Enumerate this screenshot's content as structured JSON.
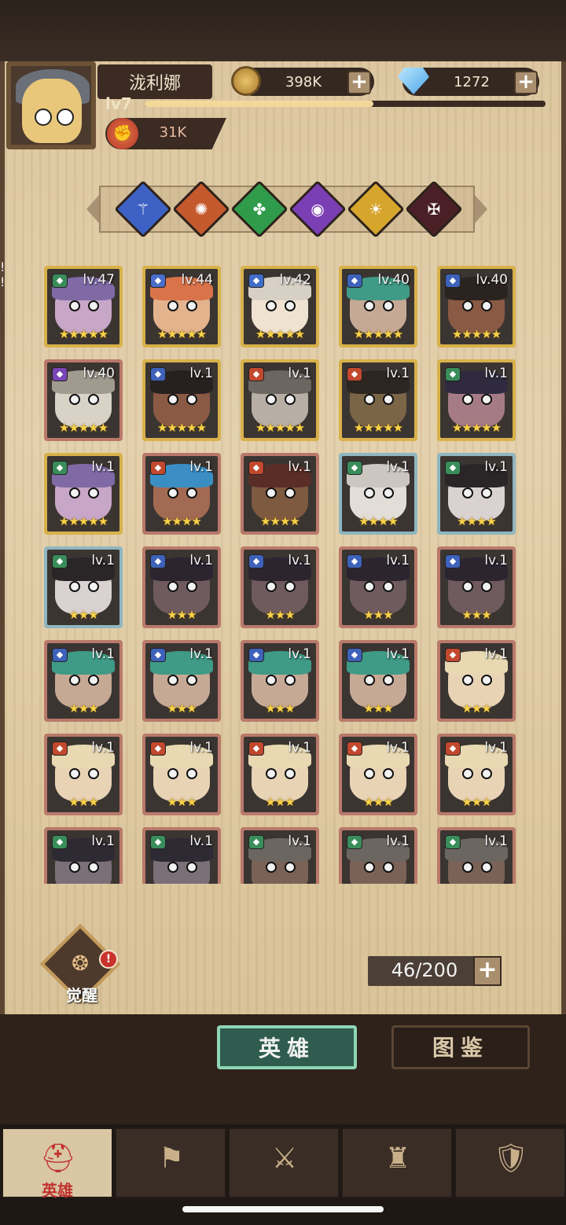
{
  "player": {
    "name": "泷利娜",
    "level_label": "lv7",
    "xp_fraction": 0.57,
    "power": "31K"
  },
  "resources": {
    "coins": "398K",
    "gems": "1272"
  },
  "filters": [
    {
      "name": "blue-faction-icon",
      "color": "#3d61c4",
      "glyph": "⚚"
    },
    {
      "name": "orange-faction-icon",
      "color": "#c5592e",
      "glyph": "✺"
    },
    {
      "name": "green-faction-icon",
      "color": "#2f9b4b",
      "glyph": "✤"
    },
    {
      "name": "purple-faction-icon",
      "color": "#7b3fb4",
      "glyph": "◉"
    },
    {
      "name": "gold-faction-icon",
      "color": "#d6a52c",
      "glyph": "☀"
    },
    {
      "name": "dark-faction-icon",
      "color": "#4a2026",
      "glyph": "✠"
    }
  ],
  "heroes": [
    {
      "level": "lv.47",
      "stars": "★★★★★",
      "frame": "#d8b14a",
      "face": "#c7a6c7",
      "hair": "#7f6aa6",
      "cls": "#3a8d5a",
      "alert": true
    },
    {
      "level": "lv.44",
      "stars": "★★★★★",
      "frame": "#d8b14a",
      "face": "#e3b38e",
      "hair": "#d9734a",
      "cls": "#4a6ec9",
      "alert": false
    },
    {
      "level": "lv.42",
      "stars": "★★★★★",
      "frame": "#d8b14a",
      "face": "#efe2d1",
      "hair": "#d7d0c4",
      "cls": "#3f6dc8",
      "alert": false
    },
    {
      "level": "lv.40",
      "stars": "★★★★★",
      "frame": "#d8b14a",
      "face": "#c6a995",
      "hair": "#3f9a86",
      "cls": "#3e62b9",
      "alert": true
    },
    {
      "level": "lv.40",
      "stars": "★★★★★",
      "frame": "#d8b14a",
      "face": "#8a5a45",
      "hair": "#2b2320",
      "cls": "#3e62b9",
      "alert": false
    },
    {
      "level": "lv.40",
      "stars": "★★★★★",
      "frame": "#b9796a",
      "face": "#d9d2c7",
      "hair": "#a19a8e",
      "cls": "#7a45b6",
      "alert": false
    },
    {
      "level": "lv.1",
      "stars": "★★★★★",
      "frame": "#d8b14a",
      "face": "#8a5a45",
      "hair": "#262020",
      "cls": "#3e62b9",
      "alert": false
    },
    {
      "level": "lv.1",
      "stars": "★★★★★",
      "frame": "#d8b14a",
      "face": "#b7afa5",
      "hair": "#6c6661",
      "cls": "#c2482e",
      "alert": false
    },
    {
      "level": "lv.1",
      "stars": "★★★★★",
      "frame": "#d8b14a",
      "face": "#7b6547",
      "hair": "#2d2620",
      "cls": "#c2482e",
      "alert": false
    },
    {
      "level": "lv.1",
      "stars": "★★★★★",
      "frame": "#d8b14a",
      "face": "#a57b86",
      "hair": "#2f2a3e",
      "cls": "#3a8d5a",
      "alert": false
    },
    {
      "level": "lv.1",
      "stars": "★★★★★",
      "frame": "#d8b14a",
      "face": "#c7a6c7",
      "hair": "#7f6aa6",
      "cls": "#3a8d5a",
      "alert": false
    },
    {
      "level": "lv.1",
      "stars": "★★★★",
      "frame": "#b9796a",
      "face": "#a26a52",
      "hair": "#3a8ec4",
      "cls": "#c2482e",
      "alert": false
    },
    {
      "level": "lv.1",
      "stars": "★★★★",
      "frame": "#b9796a",
      "face": "#7e5a41",
      "hair": "#5a2e26",
      "cls": "#c2482e",
      "alert": false
    },
    {
      "level": "lv.1",
      "stars": "★★★★",
      "frame": "#8fb6c0",
      "face": "#e2ddd6",
      "hair": "#cbc6c0",
      "cls": "#3a8d5a",
      "alert": false
    },
    {
      "level": "lv.1",
      "stars": "★★★★",
      "frame": "#8fb6c0",
      "face": "#d9d2d0",
      "hair": "#2a2527",
      "cls": "#3a8d5a",
      "alert": false
    },
    {
      "level": "lv.1",
      "stars": "★★★",
      "frame": "#8fb6c0",
      "face": "#d9d2d0",
      "hair": "#2a2527",
      "cls": "#3a8d5a",
      "alert": false
    },
    {
      "level": "lv.1",
      "stars": "★★★",
      "frame": "#b9796a",
      "face": "#6f5a5e",
      "hair": "#2c2530",
      "cls": "#3e62b9",
      "alert": false
    },
    {
      "level": "lv.1",
      "stars": "★★★",
      "frame": "#b9796a",
      "face": "#6f5a5e",
      "hair": "#2c2530",
      "cls": "#3e62b9",
      "alert": false
    },
    {
      "level": "lv.1",
      "stars": "★★★",
      "frame": "#b9796a",
      "face": "#6f5a5e",
      "hair": "#2c2530",
      "cls": "#3e62b9",
      "alert": false
    },
    {
      "level": "lv.1",
      "stars": "★★★",
      "frame": "#b9796a",
      "face": "#6f5a5e",
      "hair": "#2c2530",
      "cls": "#3e62b9",
      "alert": false
    },
    {
      "level": "lv.1",
      "stars": "★★★",
      "frame": "#b9796a",
      "face": "#c6a995",
      "hair": "#3f9a86",
      "cls": "#3e62b9",
      "alert": false
    },
    {
      "level": "lv.1",
      "stars": "★★★",
      "frame": "#b9796a",
      "face": "#c6a995",
      "hair": "#3f9a86",
      "cls": "#3e62b9",
      "alert": false
    },
    {
      "level": "lv.1",
      "stars": "★★★",
      "frame": "#b9796a",
      "face": "#c6a995",
      "hair": "#3f9a86",
      "cls": "#3e62b9",
      "alert": false
    },
    {
      "level": "lv.1",
      "stars": "★★★",
      "frame": "#b9796a",
      "face": "#c6a995",
      "hair": "#3f9a86",
      "cls": "#3e62b9",
      "alert": false
    },
    {
      "level": "lv.1",
      "stars": "★★★",
      "frame": "#b9796a",
      "face": "#e8d3b5",
      "hair": "#e8d9b2",
      "cls": "#c2482e",
      "alert": false
    },
    {
      "level": "lv.1",
      "stars": "★★★",
      "frame": "#b9796a",
      "face": "#e8d3b5",
      "hair": "#e8d9b2",
      "cls": "#c2482e",
      "alert": false
    },
    {
      "level": "lv.1",
      "stars": "★★★",
      "frame": "#b9796a",
      "face": "#e8d3b5",
      "hair": "#e8d9b2",
      "cls": "#c2482e",
      "alert": false
    },
    {
      "level": "lv.1",
      "stars": "★★★",
      "frame": "#b9796a",
      "face": "#e8d3b5",
      "hair": "#e8d9b2",
      "cls": "#c2482e",
      "alert": false
    },
    {
      "level": "lv.1",
      "stars": "★★★",
      "frame": "#b9796a",
      "face": "#e8d3b5",
      "hair": "#e8d9b2",
      "cls": "#c2482e",
      "alert": false
    },
    {
      "level": "lv.1",
      "stars": "★★★",
      "frame": "#b9796a",
      "face": "#e8d3b5",
      "hair": "#e8d9b2",
      "cls": "#c2482e",
      "alert": false
    },
    {
      "level": "lv.1",
      "stars": "",
      "frame": "#b9796a",
      "face": "#7b7077",
      "hair": "#2e2a33",
      "cls": "#3a8d5a",
      "alert": false
    },
    {
      "level": "lv.1",
      "stars": "",
      "frame": "#b9796a",
      "face": "#7b7077",
      "hair": "#2e2a33",
      "cls": "#3a8d5a",
      "alert": false
    },
    {
      "level": "lv.1",
      "stars": "",
      "frame": "#b9796a",
      "face": "#7a6256",
      "hair": "#6c6661",
      "cls": "#3a8d5a",
      "alert": false
    },
    {
      "level": "lv.1",
      "stars": "",
      "frame": "#b9796a",
      "face": "#7a6256",
      "hair": "#6c6661",
      "cls": "#3a8d5a",
      "alert": false
    },
    {
      "level": "lv.1",
      "stars": "",
      "frame": "#b9796a",
      "face": "#7a6256",
      "hair": "#6c6661",
      "cls": "#3a8d5a",
      "alert": false
    }
  ],
  "awaken": {
    "label": "觉醒",
    "alert": "!"
  },
  "capacity": "46/200",
  "tabs": {
    "hero": "英雄",
    "codex": "图鉴"
  },
  "nav": [
    {
      "name": "nav-heroes",
      "icon": "⛑",
      "label": "英雄",
      "active": true
    },
    {
      "name": "nav-expedition",
      "icon": "⚑",
      "label": "",
      "active": false
    },
    {
      "name": "nav-battle",
      "icon": "⚔",
      "label": "",
      "active": false
    },
    {
      "name": "nav-castle",
      "icon": "♜",
      "label": "",
      "active": false
    },
    {
      "name": "nav-guild",
      "icon": "🛡",
      "label": "",
      "active": false
    }
  ],
  "alert_mark": "!"
}
